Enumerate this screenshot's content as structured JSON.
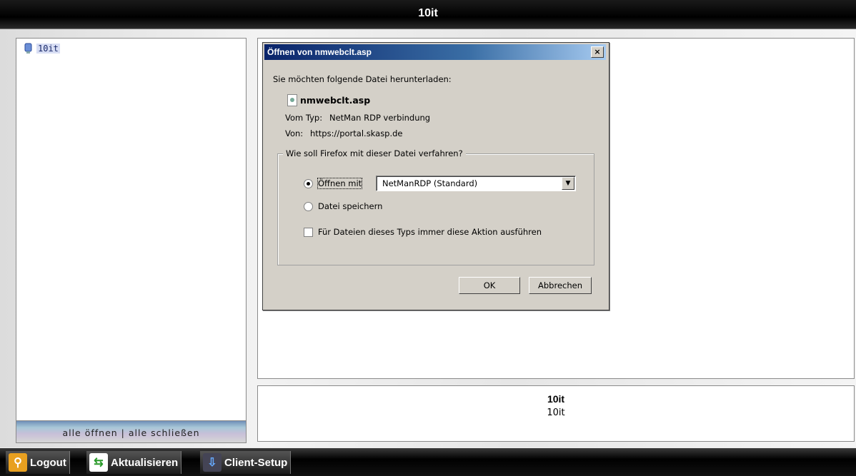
{
  "window": {
    "title": "10it"
  },
  "tree": {
    "items": [
      {
        "label": "10it"
      }
    ],
    "footer": "alle öffnen | alle schließen"
  },
  "info": {
    "heading": "10it",
    "subtitle": "10it"
  },
  "toolbar": {
    "logout_label": "Logout",
    "refresh_label": "Aktualisieren",
    "client_setup_label": "Client-Setup"
  },
  "dialog": {
    "title": "Öffnen von nmwebclt.asp",
    "close_glyph": "×",
    "prompt": "Sie möchten folgende Datei herunterladen:",
    "filename": "nmwebclt.asp",
    "type_label": "Vom Typ:",
    "type_value": "NetMan RDP verbindung",
    "from_label": "Von:",
    "from_value": "https://portal.skasp.de",
    "group_legend": "Wie soll Firefox mit dieser Datei verfahren?",
    "open_with_label": "Öffnen mit",
    "open_with_value": "NetManRDP (Standard)",
    "save_file_label": "Datei speichern",
    "always_label": "Für Dateien dieses Typs immer diese Aktion ausführen",
    "ok_label": "OK",
    "cancel_label": "Abbrechen",
    "selected_action": "open"
  },
  "colors": {
    "title_gradient_start": "#0a246a",
    "dialog_face": "#d4d0c8",
    "tree_highlight": "#d8def4"
  }
}
